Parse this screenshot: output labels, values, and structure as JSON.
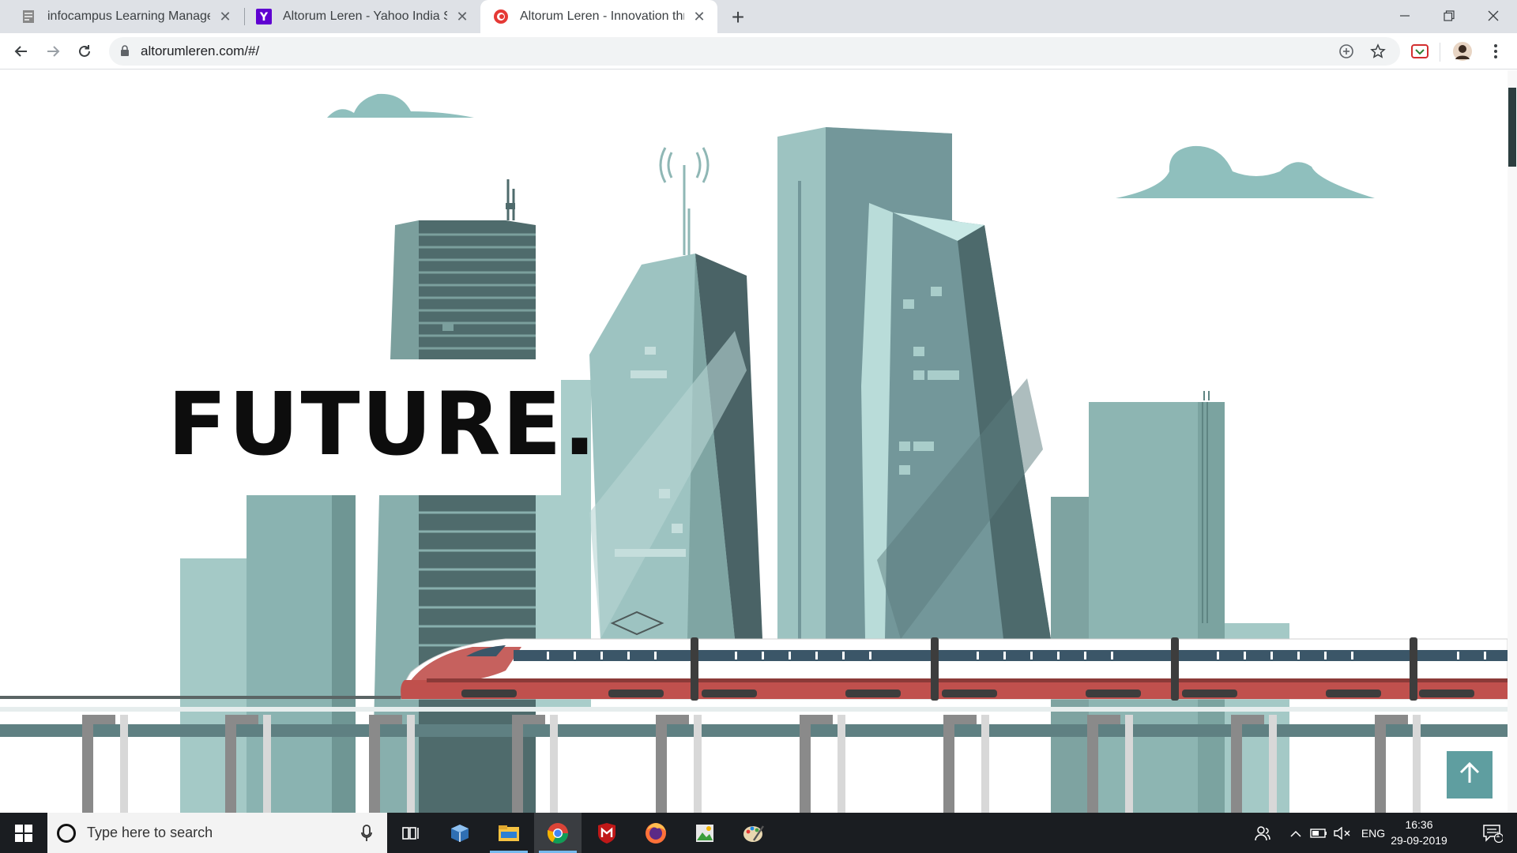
{
  "browser": {
    "tabs": [
      {
        "title": "infocampus Learning Manageme",
        "favicon": "document-icon",
        "active": false
      },
      {
        "title": "Altorum Leren - Yahoo India Sear",
        "favicon": "yahoo-icon",
        "active": false
      },
      {
        "title": "Altorum Leren - Innovation throu",
        "favicon": "altorum-icon",
        "active": true
      }
    ],
    "new_tab": "+",
    "url": "altorumleren.com/#/"
  },
  "page": {
    "hero_title": "FUTURE.",
    "back_to_top": "arrow-up-icon"
  },
  "taskbar": {
    "search_placeholder": "Type here to search",
    "language": "ENG",
    "time": "16:36",
    "date": "29-09-2019",
    "notifications": "1"
  },
  "colors": {
    "teal_light": "#9dc3c1",
    "teal_mid": "#73979a",
    "teal_dark": "#4a6366",
    "train_red": "#c0504d",
    "button_teal": "#5f9ea0"
  }
}
